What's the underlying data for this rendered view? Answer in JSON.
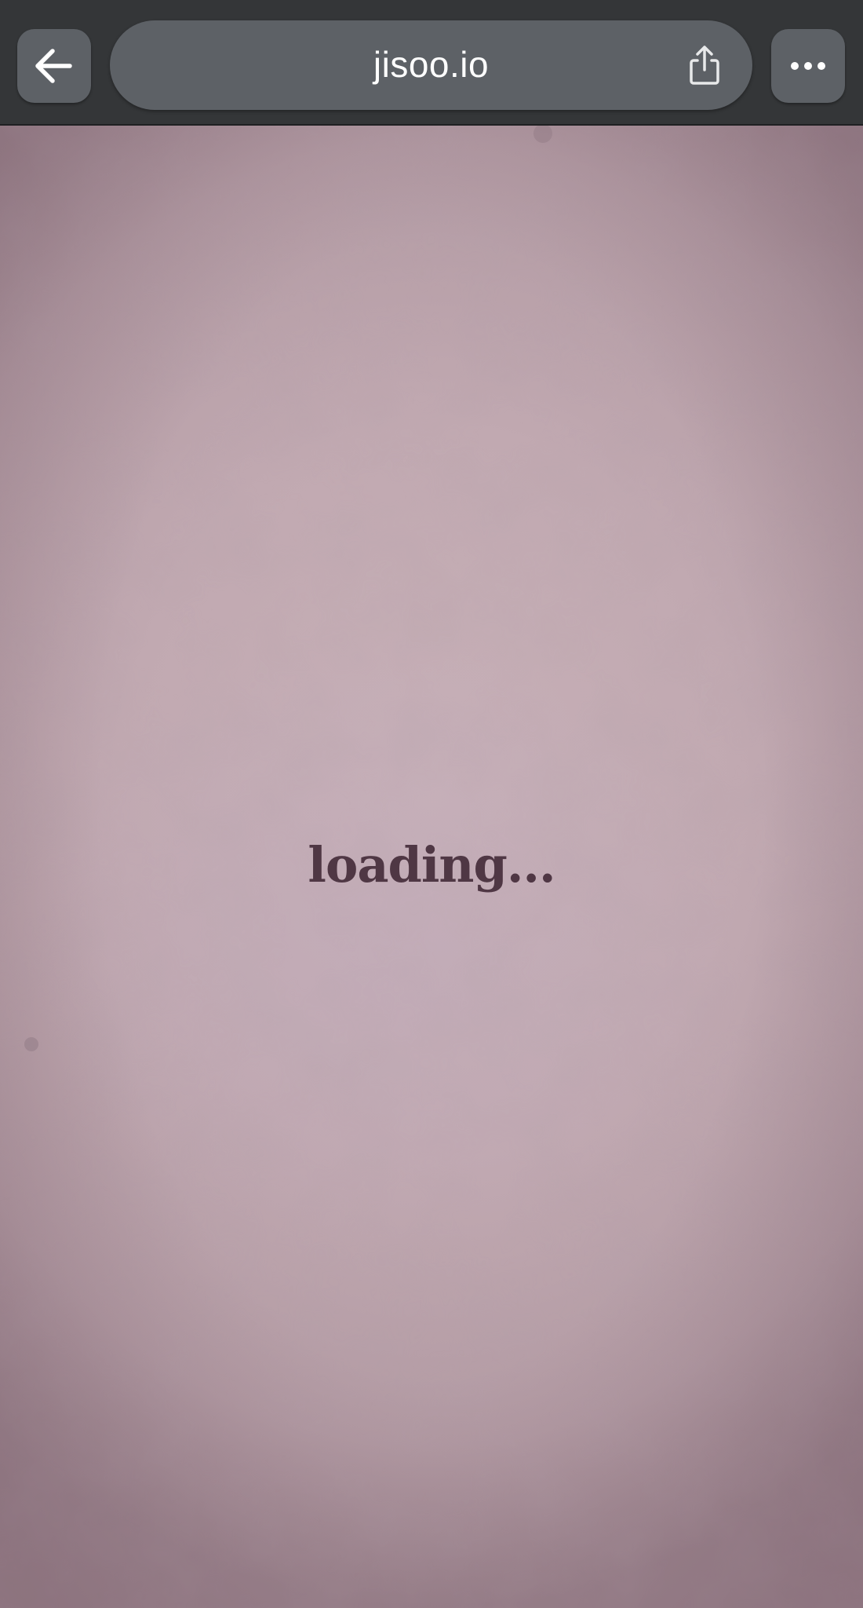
{
  "browser": {
    "url": "jisoo.io",
    "back_icon": "arrow-left-icon",
    "share_icon": "share-icon",
    "more_icon": "ellipsis-icon"
  },
  "content": {
    "loading_label": "loading..."
  },
  "colors": {
    "toolbar": "#343638",
    "control": "#5d6166",
    "background": "#c1a9b1",
    "loading_text": "#4f3744"
  }
}
